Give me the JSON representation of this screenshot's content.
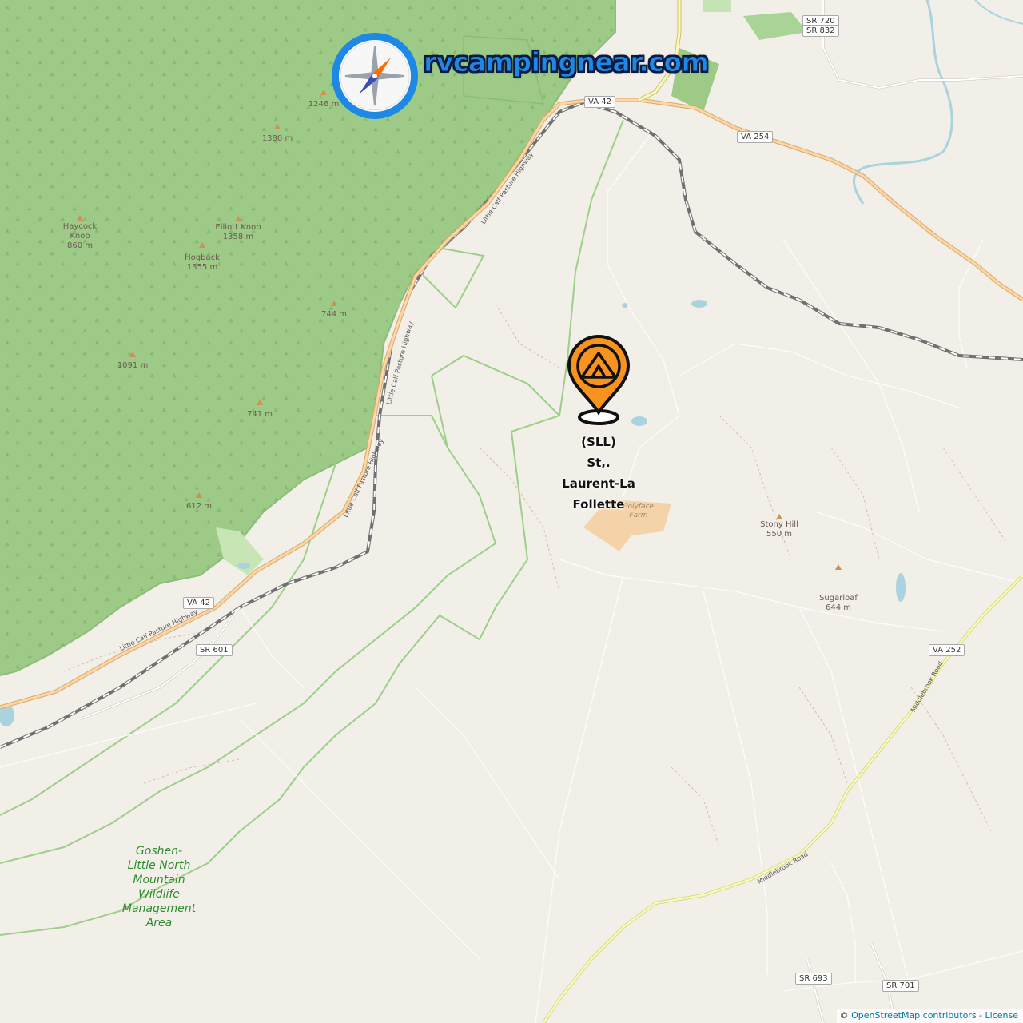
{
  "brand": {
    "text": "rvcampingnear.com",
    "logo_icon": "compass-icon"
  },
  "marker": {
    "icon": "campsite-pin-icon",
    "label_lines": [
      "(SLL)",
      "St,.",
      "Laurent-La",
      "Follette"
    ],
    "color": "#f7931e"
  },
  "peaks": [
    {
      "name": "",
      "elev": "1246 m"
    },
    {
      "name": "",
      "elev": "1380 m"
    },
    {
      "name": "Haycock Knob",
      "elev": "860 m"
    },
    {
      "name": "Elliott Knob",
      "elev": "1358 m"
    },
    {
      "name": "Hogback",
      "elev": "1355 m"
    },
    {
      "name": "",
      "elev": "744 m"
    },
    {
      "name": "",
      "elev": "1091 m"
    },
    {
      "name": "",
      "elev": "741 m"
    },
    {
      "name": "",
      "elev": "612 m"
    },
    {
      "name": "Stony Hill",
      "elev": "550 m"
    },
    {
      "name": "Sugarloaf",
      "elev": "644 m"
    }
  ],
  "shields": [
    "SR 720",
    "SR 832",
    "VA 42",
    "VA 254",
    "VA 42",
    "SR 601",
    "VA 252",
    "SR 693",
    "SR 701"
  ],
  "road_names": [
    "Little Calf Pasture Highway",
    "Little Calf Pasture Highway",
    "Little Calf Pasture Highway",
    "Little Calf Pasture Highway",
    "Middlebrook Road",
    "Middlebrook Road"
  ],
  "areas": {
    "wildlife": [
      "Goshen-",
      "Little North",
      "Mountain",
      "Wildlife",
      "Management",
      "Area"
    ],
    "farm": [
      "Polyface",
      "Farm"
    ]
  },
  "attribution": {
    "prefix": "©",
    "link": "OpenStreetMap contributors",
    "sep": " - ",
    "license": "License"
  },
  "colors": {
    "land": "#f2efe9",
    "forest": "#9fcf8a",
    "water": "#aad3df",
    "primary_road": "#fcd6a4",
    "secondary_road": "#f7fabf",
    "rail": "#707070",
    "brand": "#1e88e5"
  }
}
